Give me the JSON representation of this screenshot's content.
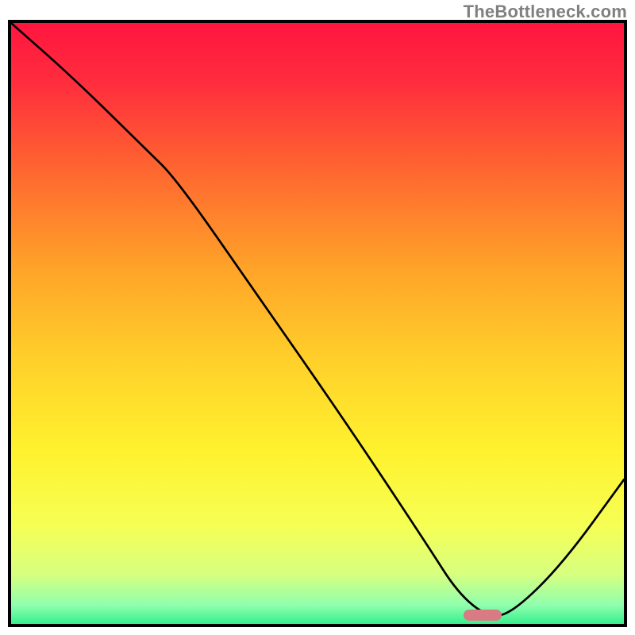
{
  "watermark": "TheBottleneck.com",
  "chart_data": {
    "type": "line",
    "title": "",
    "xlabel": "",
    "ylabel": "",
    "xlim": [
      0,
      100
    ],
    "ylim": [
      0,
      100
    ],
    "series": [
      {
        "name": "bottleneck-curve",
        "x": [
          0,
          10,
          22,
          27,
          40,
          55,
          68,
          73,
          78,
          82,
          90,
          100
        ],
        "y": [
          100,
          91,
          79,
          74,
          55,
          33,
          13,
          5,
          1,
          2,
          10,
          24
        ]
      }
    ],
    "marker": {
      "name": "optimum",
      "x": 77,
      "y": 1.5,
      "color": "#d87b83"
    },
    "gradient": [
      {
        "offset": 0.0,
        "color": "#ff153f"
      },
      {
        "offset": 0.1,
        "color": "#ff2e3d"
      },
      {
        "offset": 0.25,
        "color": "#ff6a2f"
      },
      {
        "offset": 0.4,
        "color": "#ffa329"
      },
      {
        "offset": 0.55,
        "color": "#ffd02a"
      },
      {
        "offset": 0.7,
        "color": "#fff22e"
      },
      {
        "offset": 0.82,
        "color": "#f6ff55"
      },
      {
        "offset": 0.9,
        "color": "#d7ff80"
      },
      {
        "offset": 0.95,
        "color": "#8fffad"
      },
      {
        "offset": 1.0,
        "color": "#00e57a"
      }
    ]
  }
}
